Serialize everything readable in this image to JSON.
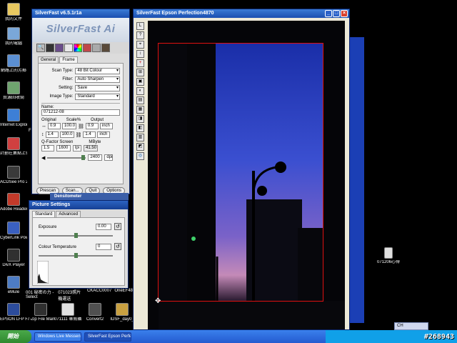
{
  "desktop": {
    "icons": [
      {
        "label": "我的文件",
        "color": "#e8c860"
      },
      {
        "label": "我的電腦",
        "color": "#7aa7d8"
      },
      {
        "label": "網路上的芳鄰",
        "color": "#5b8fd2"
      },
      {
        "label": "資源回收筒",
        "color": "#6fa36f"
      },
      {
        "label": "Internet Explorer",
        "color": "#3d7fd6"
      },
      {
        "label": "計劃在集點上傳",
        "color": "#d04040"
      },
      {
        "label": "ACDSee Pro 2",
        "color": "#3a3a3a"
      },
      {
        "label": "Adobe Reader 7.0",
        "color": "#c23a2a"
      },
      {
        "label": "CyberLink PowerDVD",
        "color": "#3a60c0"
      },
      {
        "label": "DivX Player",
        "color": "#303030"
      },
      {
        "label": "eMule",
        "color": "#4d7cc4"
      },
      {
        "label": "EPSON LFP Remote Panel",
        "color": "#2c4c9c"
      },
      {
        "label": "7-Zip File Manager",
        "color": "#303030"
      },
      {
        "label": "071111 華將攝影展心得",
        "color": "#e0e0e0"
      },
      {
        "label": "Convert2",
        "color": "#505050"
      },
      {
        "label": "IDSF_day0_",
        "color": "#c8a040"
      },
      {
        "label": "071206心得",
        "color": "#e0e0e0"
      }
    ],
    "row_bottom_labels": [
      "001 秘密の力 -Select",
      "071023照片機運送",
      "CKACC0007",
      "OneEF48"
    ],
    "mid_label": "Fi"
  },
  "silverfast": {
    "title": "SilverFast v6.5.1r1a",
    "logo": "SilverFast Ai",
    "tabs": [
      "General",
      "Frame"
    ],
    "active_tab": "Frame",
    "scan_type": {
      "label": "Scan Type:",
      "value": "48 Bit Colour"
    },
    "filter": {
      "label": "Filter:",
      "value": "Auto Sharpen"
    },
    "setting": {
      "label": "Setting:",
      "value": "Save"
    },
    "image_type": {
      "label": "Image Type:",
      "value": "Standard"
    },
    "name_label": "Name:",
    "name_value": "071212-08",
    "original_label": "Original",
    "scale_label": "Scale%",
    "output_label": "Output",
    "orig_w": "0.9",
    "scale_w": "100.0",
    "out_w": "0.9",
    "unit_w": "inch",
    "orig_h": "1.4",
    "scale_h": "100.0",
    "out_h": "1.4",
    "unit_h": "inch",
    "qfactor_label": "Q-Factor Screen",
    "mbyte_label": "MByte",
    "qfactor": "1.5",
    "screen": "1600",
    "lpi": "lpi",
    "mbyte": "41.50",
    "resolution": "2400",
    "dpi": "dpi",
    "buttons": [
      "Prescan",
      "Scan...",
      "Quit",
      "Options"
    ]
  },
  "densitometer": "Densitometer",
  "picture_settings": {
    "title": "Picture Settings",
    "tabs": [
      "Standard",
      "Advanced"
    ],
    "exposure_label": "Exposure",
    "exposure_value": "0.00",
    "colour_temp_label": "Colour Temperature",
    "colour_temp_value": "0"
  },
  "preview": {
    "title": "SilverFast Epson Perfection4870",
    "tools": [
      "L",
      "?",
      "⌖",
      "↕",
      "+",
      "⊞",
      "▣",
      "◐",
      "▤",
      "▦",
      "◨",
      "◧",
      "▥",
      "◩",
      "◎"
    ]
  },
  "taskbar": {
    "start": "開始",
    "items": [
      {
        "label": "Windows Live Messen...",
        "active": false
      },
      {
        "label": "SilverFast Epson Perfe...",
        "active": true
      }
    ],
    "ime": "CH"
  },
  "watermark": "#268943"
}
